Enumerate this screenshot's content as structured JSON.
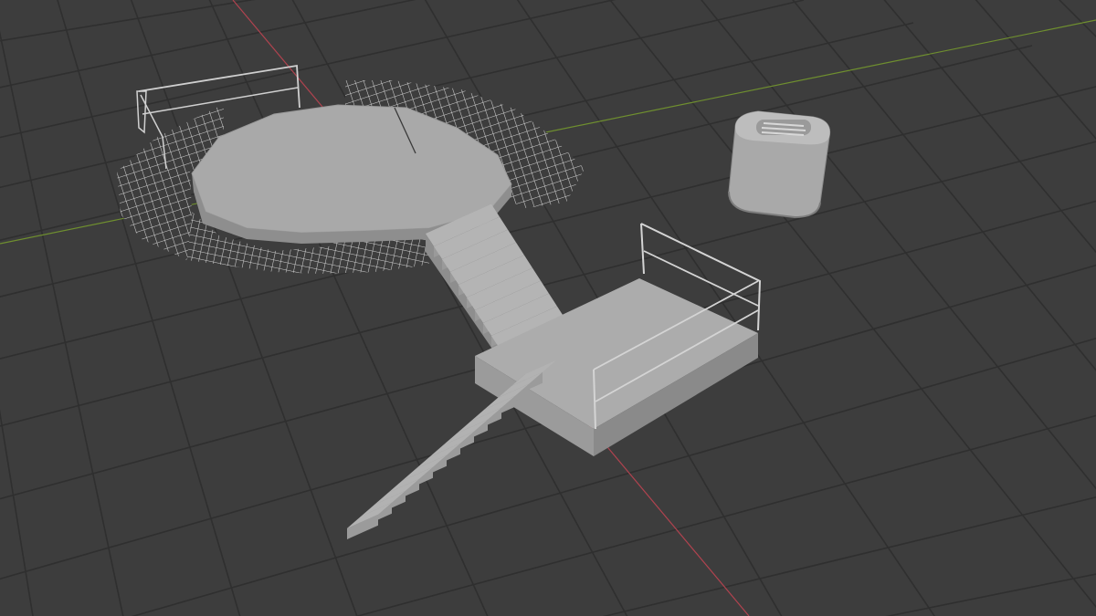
{
  "viewport": {
    "background": "#3d3d3d",
    "grid_color": "#2f2f2f",
    "x_axis_color": "#b0434f",
    "y_axis_color": "#6f8f2f",
    "mesh_fill": "#a7a7a7",
    "mesh_light": "#b9b9b9",
    "mesh_dark": "#8c8c8c",
    "wire_color": "#cfcfcf"
  },
  "scene_objects": [
    {
      "name": "circular-platform",
      "type": "mesh"
    },
    {
      "name": "wireframe-railing-ring",
      "type": "wireframe"
    },
    {
      "name": "upper-staircase",
      "type": "mesh"
    },
    {
      "name": "landing-platform",
      "type": "mesh"
    },
    {
      "name": "lower-staircase",
      "type": "mesh"
    },
    {
      "name": "cylinder-vent",
      "type": "mesh"
    }
  ]
}
